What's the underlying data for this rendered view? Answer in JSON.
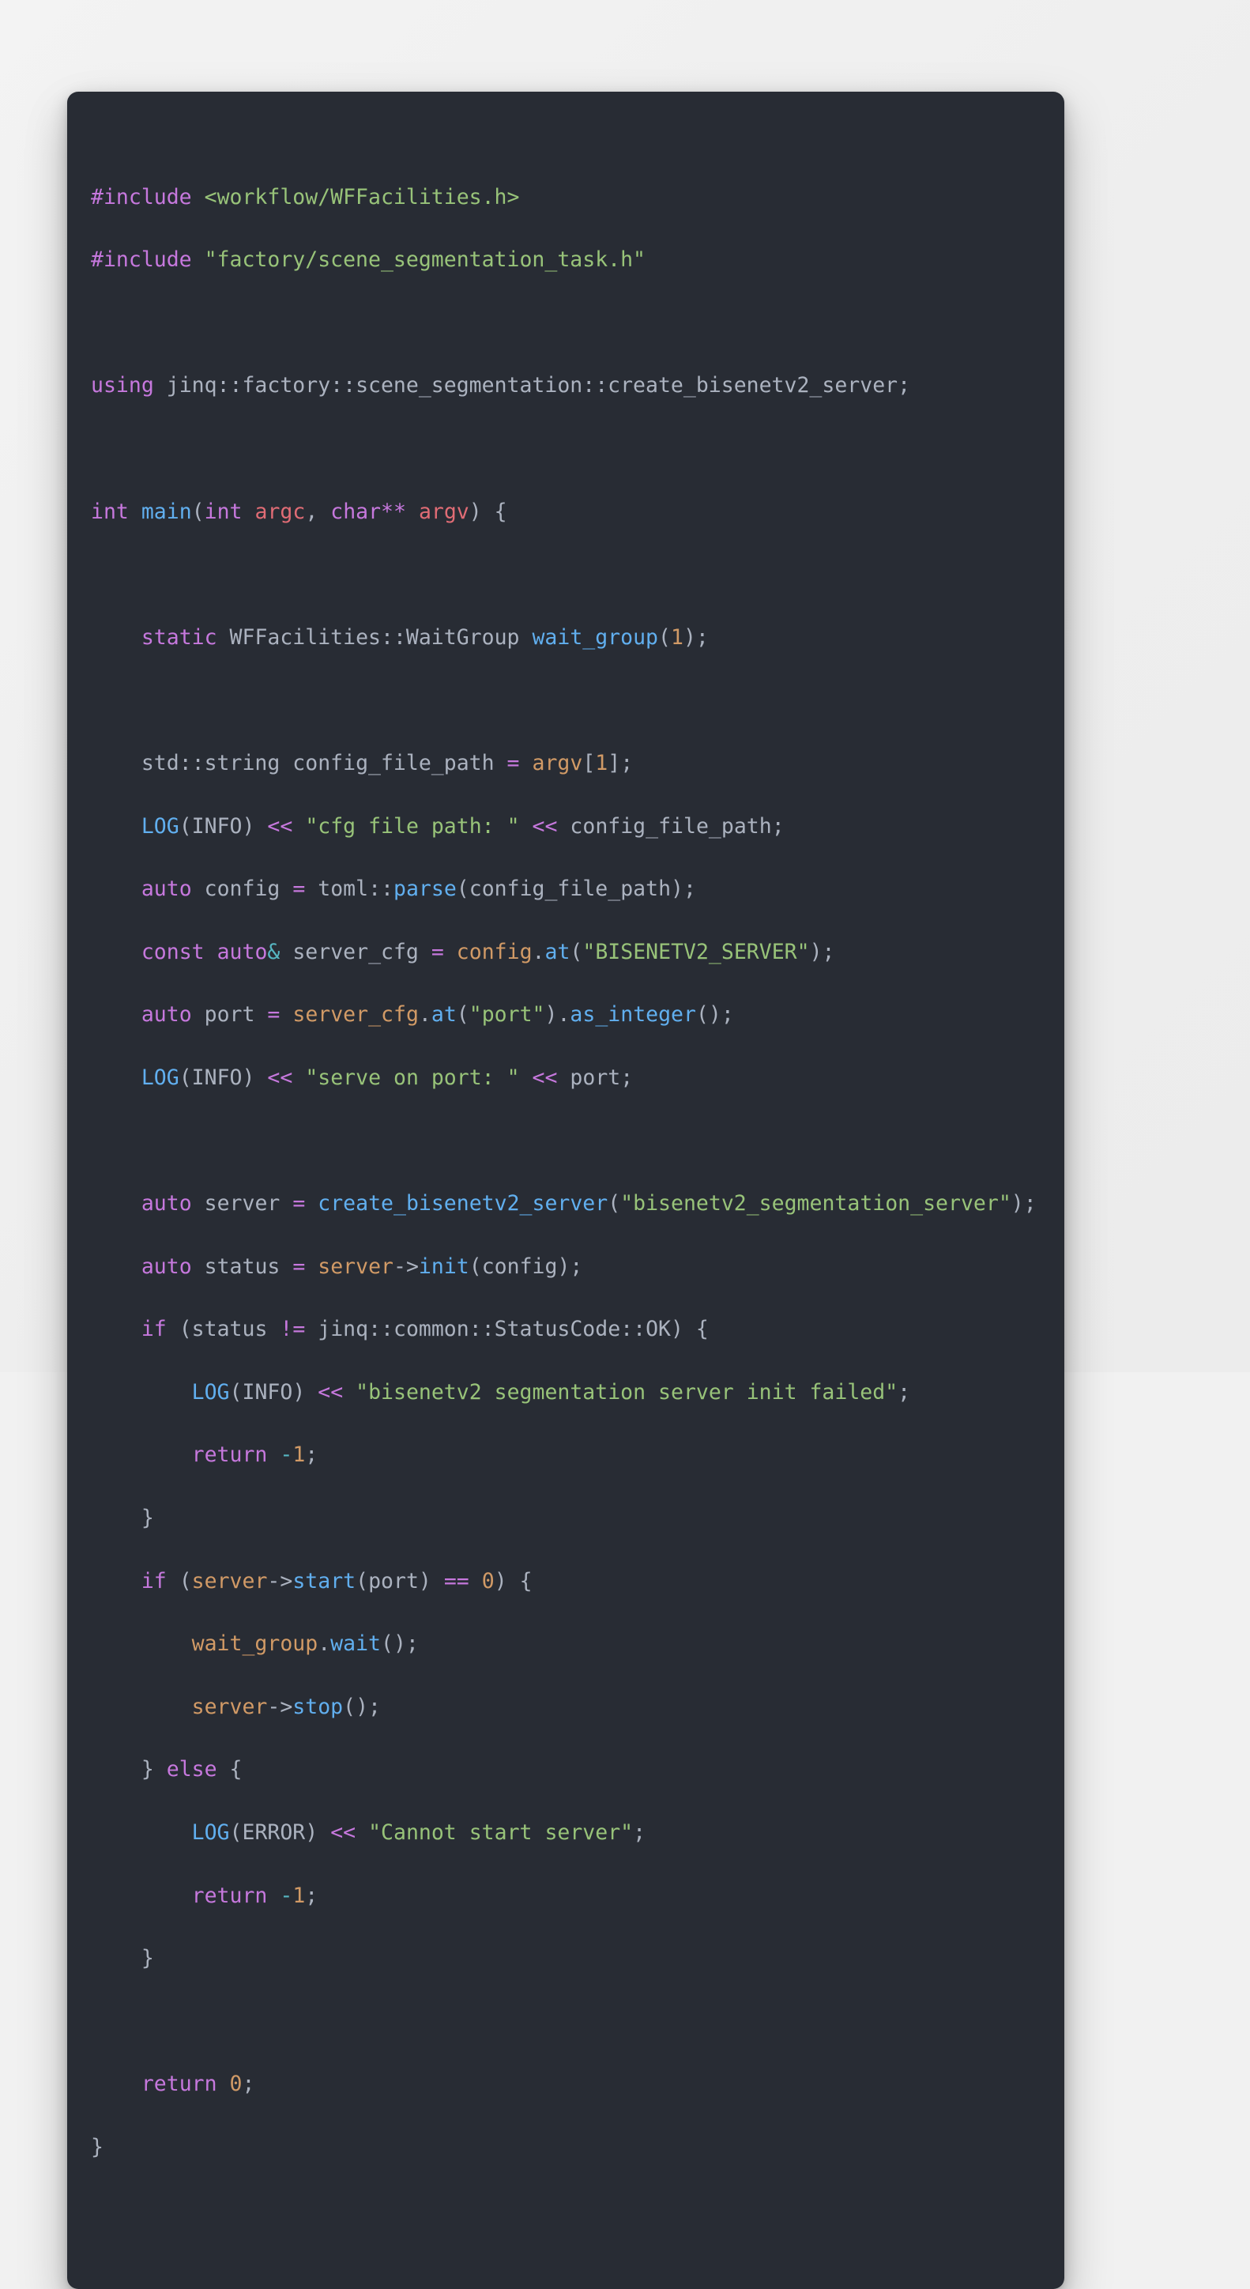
{
  "page": {
    "background": "#f1f1f1",
    "card_background": "#282c34",
    "language": "cpp"
  },
  "theme": {
    "keyword": "#c678dd",
    "function": "#61afef",
    "string": "#98c379",
    "number": "#d19a66",
    "variable": "#d19a66",
    "parameter": "#e06c75",
    "operator": "#c678dd",
    "operator_alt": "#56b6c2",
    "identifier": "#abb2bf"
  },
  "code": {
    "lines": [
      {
        "n": 1,
        "text": "#include <workflow/WFFacilities.h>"
      },
      {
        "n": 2,
        "text": "#include \"factory/scene_segmentation_task.h\""
      },
      {
        "n": 3,
        "text": ""
      },
      {
        "n": 4,
        "text": "using jinq::factory::scene_segmentation::create_bisenetv2_server;"
      },
      {
        "n": 5,
        "text": ""
      },
      {
        "n": 6,
        "text": "int main(int argc, char** argv) {"
      },
      {
        "n": 7,
        "text": ""
      },
      {
        "n": 8,
        "text": "    static WFFacilities::WaitGroup wait_group(1);"
      },
      {
        "n": 9,
        "text": ""
      },
      {
        "n": 10,
        "text": "    std::string config_file_path = argv[1];"
      },
      {
        "n": 11,
        "text": "    LOG(INFO) << \"cfg file path: \" << config_file_path;"
      },
      {
        "n": 12,
        "text": "    auto config = toml::parse(config_file_path);"
      },
      {
        "n": 13,
        "text": "    const auto& server_cfg = config.at(\"BISENETV2_SERVER\");"
      },
      {
        "n": 14,
        "text": "    auto port = server_cfg.at(\"port\").as_integer();"
      },
      {
        "n": 15,
        "text": "    LOG(INFO) << \"serve on port: \" << port;"
      },
      {
        "n": 16,
        "text": ""
      },
      {
        "n": 17,
        "text": "    auto server = create_bisenetv2_server(\"bisenetv2_segmentation_server\");"
      },
      {
        "n": 18,
        "text": "    auto status = server->init(config);"
      },
      {
        "n": 19,
        "text": "    if (status != jinq::common::StatusCode::OK) {"
      },
      {
        "n": 20,
        "text": "        LOG(INFO) << \"bisenetv2 segmentation server init failed\";"
      },
      {
        "n": 21,
        "text": "        return -1;"
      },
      {
        "n": 22,
        "text": "    }"
      },
      {
        "n": 23,
        "text": "    if (server->start(port) == 0) {"
      },
      {
        "n": 24,
        "text": "        wait_group.wait();"
      },
      {
        "n": 25,
        "text": "        server->stop();"
      },
      {
        "n": 26,
        "text": "    } else {"
      },
      {
        "n": 27,
        "text": "        LOG(ERROR) << \"Cannot start server\";"
      },
      {
        "n": 28,
        "text": "        return -1;"
      },
      {
        "n": 29,
        "text": "    }"
      },
      {
        "n": 30,
        "text": ""
      },
      {
        "n": 31,
        "text": "    return 0;"
      },
      {
        "n": 32,
        "text": "}"
      }
    ],
    "tokens": {
      "include_directive": "#include",
      "include_path_angle": "<workflow/WFFacilities.h>",
      "include_path_quote": "\"factory/scene_segmentation_task.h\"",
      "using_keyword": "using",
      "using_target": "jinq::factory::scene_segmentation::create_bisenetv2_server;",
      "type_int": "int",
      "fn_main": "main",
      "param_argc": "argc",
      "type_char": "char**",
      "param_argv": "argv",
      "kw_static": "static",
      "type_waitgroup": "WFFacilities::WaitGroup",
      "var_wait_group": "wait_group",
      "num_one": "1",
      "type_std_string": "std::string",
      "var_config_file_path": "config_file_path",
      "fn_log": "LOG",
      "level_info": "INFO",
      "level_error": "ERROR",
      "stream_op": "<<",
      "str_cfg_file_path": "\"cfg file path: \"",
      "kw_auto": "auto",
      "var_config": "config",
      "ns_toml": "toml::",
      "fn_parse": "parse",
      "kw_const": "const",
      "amp": "&",
      "var_server_cfg": "server_cfg",
      "fn_at": "at",
      "str_bisenetv2_server": "\"BISENETV2_SERVER\"",
      "var_port": "port",
      "str_port": "\"port\"",
      "fn_as_integer": "as_integer",
      "str_serve_on_port": "\"serve on port: \"",
      "var_server": "server",
      "fn_create_bisenetv2_server": "create_bisenetv2_server",
      "str_segmentation_server": "\"bisenetv2_segmentation_server\"",
      "var_status": "status",
      "fn_init": "init",
      "kw_if": "if",
      "op_ne": "!=",
      "enum_statuscode_ok": "jinq::common::StatusCode::OK",
      "str_init_failed": "\"bisenetv2 segmentation server init failed\"",
      "kw_return": "return",
      "num_neg_one": "-1",
      "fn_start": "start",
      "op_eq": "==",
      "num_zero": "0",
      "fn_wait": "wait",
      "fn_stop": "stop",
      "kw_else": "else",
      "str_cannot_start": "\"Cannot start server\""
    }
  }
}
